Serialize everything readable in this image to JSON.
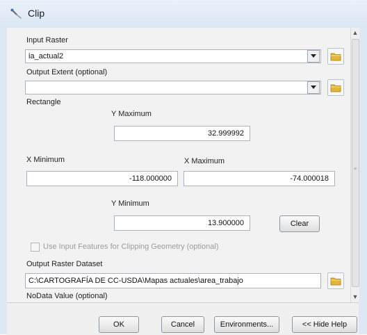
{
  "window": {
    "title": "Clip"
  },
  "input_raster": {
    "label": "Input Raster",
    "value": "ia_actual2"
  },
  "output_extent": {
    "label": "Output Extent (optional)",
    "value": ""
  },
  "rectangle": {
    "label": "Rectangle",
    "y_max_label": "Y Maximum",
    "y_max": "32.999992",
    "x_min_label": "X Minimum",
    "x_min": "-118.000000",
    "x_max_label": "X Maximum",
    "x_max": "-74.000018",
    "y_min_label": "Y Minimum",
    "y_min": "13.900000",
    "clear_label": "Clear"
  },
  "use_input_features": {
    "label": "Use Input Features for Clipping Geometry (optional)",
    "checked": false
  },
  "output_raster": {
    "label": "Output Raster Dataset",
    "value": "C:\\CARTOGRAFÍA DE CC-USDA\\Mapas actuales\\area_trabajo"
  },
  "nodata": {
    "label": "NoData Value (optional)"
  },
  "buttons": {
    "ok": "OK",
    "cancel": "Cancel",
    "environments": "Environments...",
    "hide_help": "<< Hide Help"
  }
}
